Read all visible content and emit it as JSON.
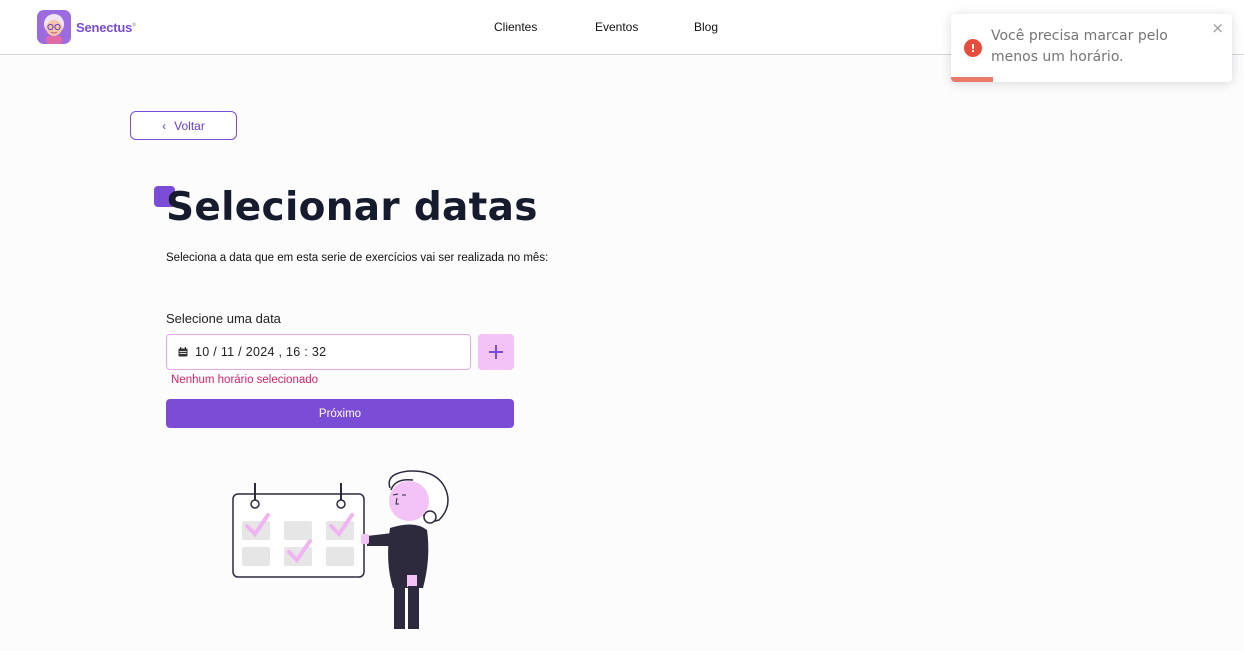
{
  "header": {
    "brand": "Senectus",
    "brand_mark": "®",
    "nav": [
      {
        "label": "Clientes"
      },
      {
        "label": "Eventos"
      },
      {
        "label": "Blog"
      }
    ]
  },
  "toast": {
    "icon": "exclamation-circle-icon",
    "icon_glyph": "!",
    "message": "Você precisa marcar pelo menos um horário.",
    "close_glyph": "×",
    "progress": 0.15,
    "color": "#e74c3c"
  },
  "back_button": {
    "label": "Voltar",
    "icon": "chevron-left-icon",
    "glyph": "‹"
  },
  "page": {
    "title": "Selecionar datas",
    "subtitle": "Seleciona a data que em esta serie de exercícios vai ser realizada no mês:"
  },
  "form": {
    "date_label": "Selecione uma data",
    "date_value": "10 / 11 / 2024 , 16 : 32",
    "add_icon": "plus-icon",
    "error": "Nenhum horário selecionado",
    "next_label": "Próximo"
  },
  "colors": {
    "accent": "#7b4cd6",
    "pink": "#f3c2f7",
    "error": "#d6236a",
    "toast_error": "#e74c3c"
  }
}
